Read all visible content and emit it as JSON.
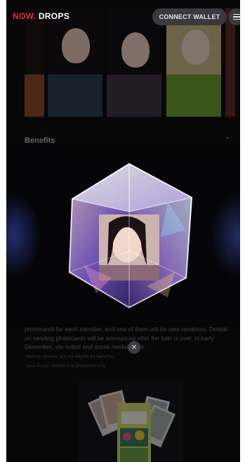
{
  "header": {
    "logo_now": "NOW.",
    "logo_drops": "DROPS",
    "connect_label": "CONNECT WALLET"
  },
  "benefits": {
    "title": "Benefits",
    "description": "photocards for each member, and one of them will be sent randomly. Details on sending photocards will be announced after the sale is over, in early December, via notice and social media posts.",
    "note_1": "*Airdrop winners are not eligible for benefits.",
    "note_2": "*One ID can receive one photocard only."
  },
  "modal": {
    "close_glyph": "✕"
  },
  "colors": {
    "accent": "#e2303a",
    "background": "#0d0d10"
  }
}
